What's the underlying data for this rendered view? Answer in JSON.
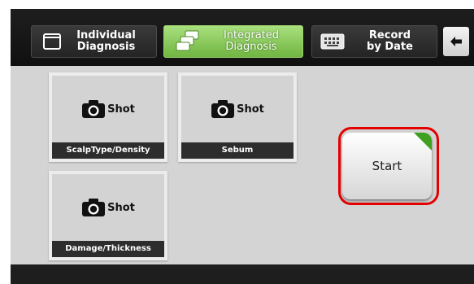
{
  "tabs": {
    "individual": {
      "label": "Individual\nDiagnosis",
      "icon": "window-icon"
    },
    "integrated": {
      "label": "Integrated\nDiagnosis",
      "icon": "stacked-windows-icon",
      "active": true
    },
    "record": {
      "label": "Record\nby Date",
      "icon": "keyboard-icon"
    },
    "back": {
      "icon": "back-arrow-icon"
    }
  },
  "cards": [
    {
      "shot_label": "Shot",
      "label": "ScalpType/Density"
    },
    {
      "shot_label": "Shot",
      "label": "Sebum"
    },
    {
      "shot_label": "Shot",
      "label": "Damage/Thickness"
    }
  ],
  "start": {
    "label": "Start",
    "highlighted": true
  },
  "colors": {
    "accent_green": "#70b541",
    "highlight_red": "#e30000"
  }
}
